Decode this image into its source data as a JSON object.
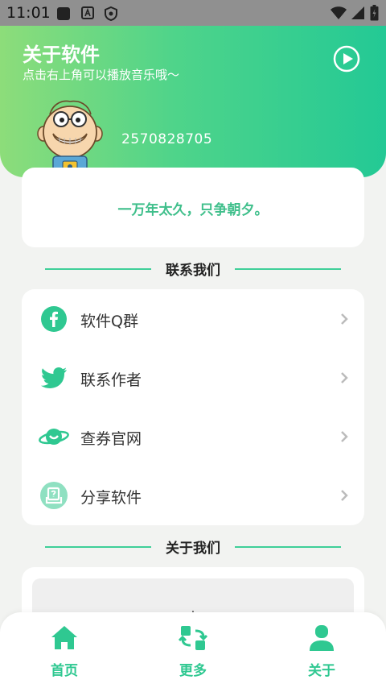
{
  "status_bar": {
    "time": "11:01",
    "icons": [
      "app-square-icon",
      "a-badge-icon",
      "shield-icon",
      "wifi-icon",
      "signal-icon",
      "battery-charging-icon"
    ]
  },
  "header": {
    "title": "关于软件",
    "subtitle": "点击右上角可以播放音乐哦～",
    "user_id": "2570828705",
    "play_icon": "play-circle-icon",
    "avatar": "cartoon-avatar"
  },
  "quote": "一万年太久，只争朝夕。",
  "contact": {
    "heading": "联系我们",
    "items": [
      {
        "label": "软件Q群",
        "icon": "facebook-icon"
      },
      {
        "label": "联系作者",
        "icon": "twitter-bird-icon"
      },
      {
        "label": "查券官网",
        "icon": "planet-icon"
      },
      {
        "label": "分享软件",
        "icon": "share-box-icon"
      }
    ]
  },
  "about": {
    "heading": "关于我们",
    "content": "."
  },
  "tabs": [
    {
      "label": "首页",
      "icon": "home-icon"
    },
    {
      "label": "更多",
      "icon": "swap-grid-icon"
    },
    {
      "label": "关于",
      "icon": "user-icon"
    }
  ],
  "colors": {
    "accent": "#2fc891",
    "header_gradient_start": "#8ddd7a",
    "header_gradient_end": "#23c995",
    "background": "#f2f3f1"
  }
}
